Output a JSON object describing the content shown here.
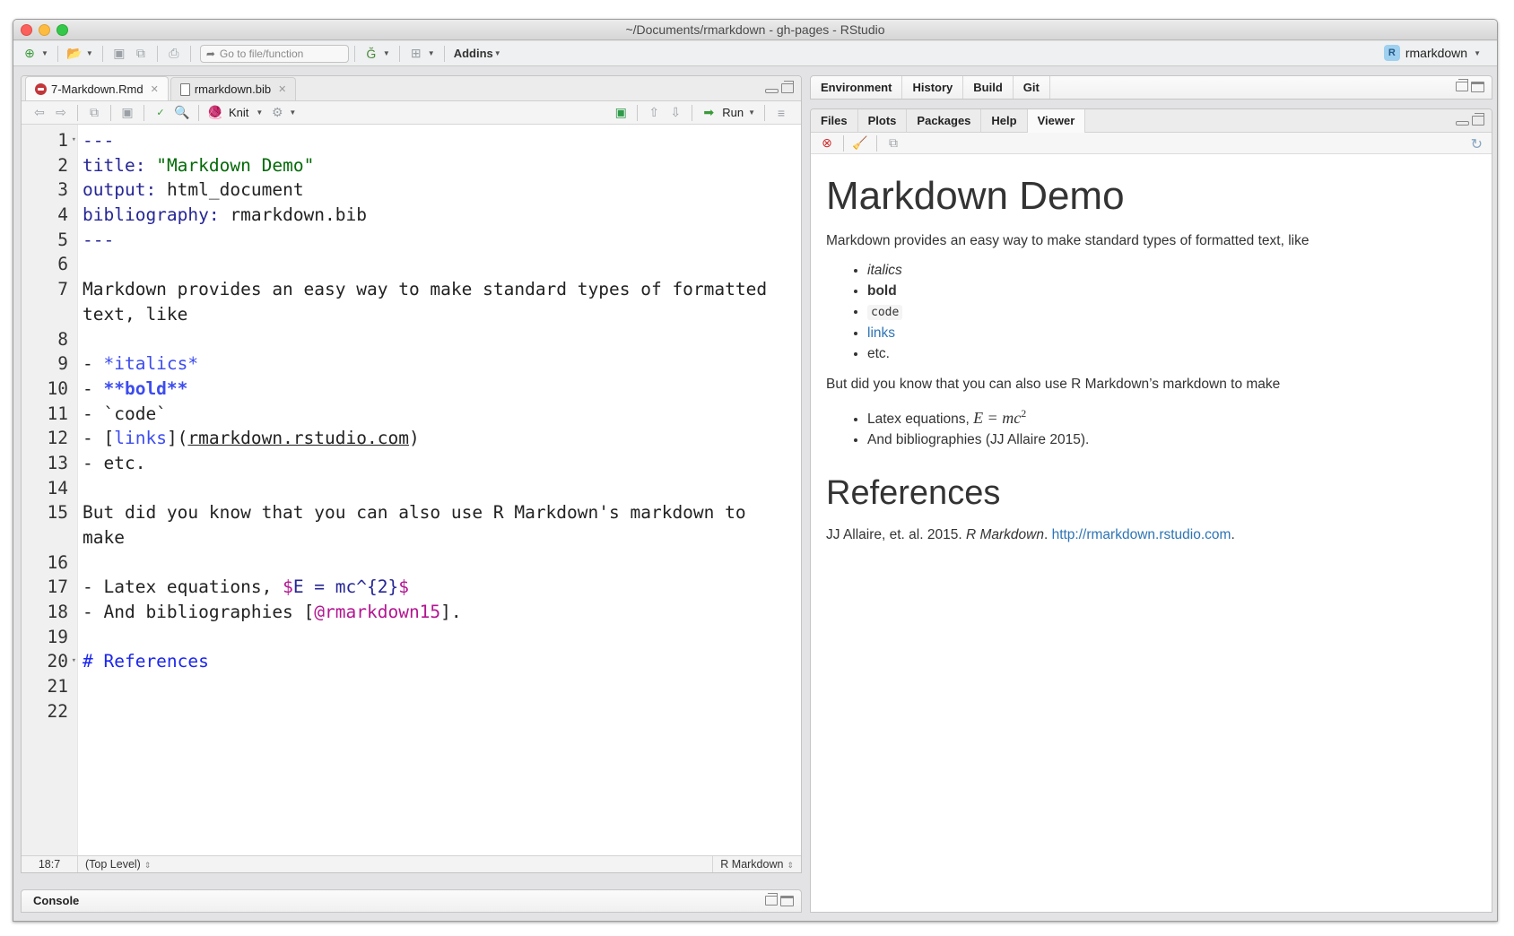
{
  "window": {
    "title": "~/Documents/rmarkdown - gh-pages - RStudio"
  },
  "main_toolbar": {
    "new_file_icon": "new-file-icon",
    "open_file_icon": "open-folder-icon",
    "save_icon": "save-icon",
    "save_all_icon": "save-all-icon",
    "print_icon": "print-icon",
    "goto_placeholder": "Go to file/function",
    "vcs_icon": "git-icon",
    "layout_icon": "grid-layout-icon",
    "addins_label": "Addins",
    "project_label": "rmarkdown"
  },
  "editor": {
    "tabs": [
      {
        "label": "7-Markdown.Rmd",
        "icon": "rmd-file-icon",
        "active": true
      },
      {
        "label": "rmarkdown.bib",
        "icon": "text-file-icon",
        "active": false
      }
    ],
    "toolbar": {
      "knit_label": "Knit",
      "run_label": "Run"
    },
    "line_numbers": [
      "1",
      "2",
      "3",
      "4",
      "5",
      "6",
      "7",
      "",
      "8",
      "9",
      "10",
      "11",
      "12",
      "13",
      "14",
      "15",
      "",
      "16",
      "17",
      "18",
      "19",
      "20",
      "21",
      "22"
    ],
    "lines": {
      "l1": "---",
      "l2_key": "title:",
      "l2_val": "\"Markdown Demo\"",
      "l3_key": "output:",
      "l3_val": "html_document",
      "l4_key": "bibliography:",
      "l4_val": "rmarkdown.bib",
      "l5": "---",
      "l7a": "Markdown provides an easy way to make standard types of formatted",
      "l7b": "text, like",
      "l9_dash": "- ",
      "l9_val": "*italics*",
      "l10_dash": "- ",
      "l10_val": "**bold**",
      "l11": "- `code`",
      "l12_a": "- [",
      "l12_link": "links",
      "l12_b": "](",
      "l12_url": "rmarkdown.rstudio.com",
      "l12_c": ")",
      "l13": "- etc.",
      "l15a": "But did you know that you can also use R Markdown's markdown to",
      "l15b": "make",
      "l17_a": "- Latex equations, ",
      "l17_d1": "$",
      "l17_m": "E = mc^{2}",
      "l17_d2": "$",
      "l18_a": "- And bibliographies [",
      "l18_cite": "@rmarkdown15",
      "l18_b": "].",
      "l20": "# References"
    },
    "status": {
      "position": "18:7",
      "scope": "(Top Level)",
      "mode": "R Markdown"
    }
  },
  "console": {
    "label": "Console"
  },
  "top_right_pane": {
    "tabs": [
      "Environment",
      "History",
      "Build",
      "Git"
    ]
  },
  "bottom_right_pane": {
    "tabs": [
      "Files",
      "Plots",
      "Packages",
      "Help",
      "Viewer"
    ],
    "active_tab": "Viewer"
  },
  "viewer": {
    "h1": "Markdown Demo",
    "p1": "Markdown provides an easy way to make standard types of formatted text, like",
    "list1": {
      "italics": "italics",
      "bold": "bold",
      "code": "code",
      "links": "links",
      "etc": "etc."
    },
    "p2": "But did you know that you can also use R Markdown’s markdown to make",
    "list2": {
      "latex_prefix": "Latex equations, ",
      "latex_math": "E = mc",
      "latex_sup": "2",
      "biblio": "And bibliographies (JJ Allaire 2015)."
    },
    "h2": "References",
    "ref": {
      "authors": "JJ Allaire, et. al. 2015. ",
      "title": "R Markdown",
      "sep": ". ",
      "url": "http://rmarkdown.rstudio.com",
      "end": "."
    }
  }
}
